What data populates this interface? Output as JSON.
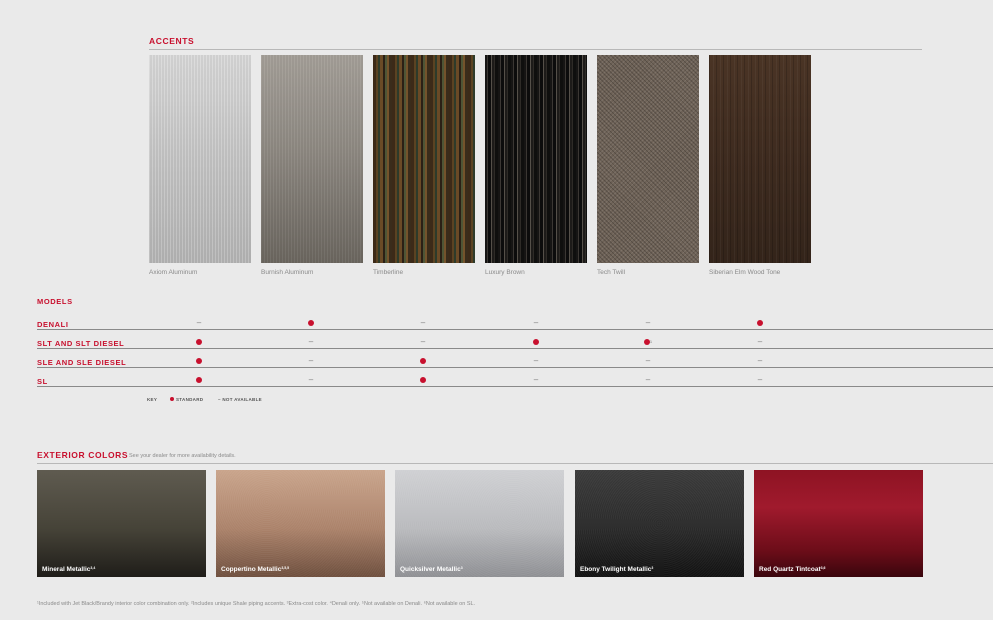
{
  "accents": {
    "title": "ACCENTS",
    "items": [
      {
        "label": "Axiom Aluminum",
        "swatch": "axiom-aluminum-swatch"
      },
      {
        "label": "Burnish Aluminum",
        "swatch": "burnish-aluminum-swatch"
      },
      {
        "label": "Timberline",
        "swatch": "timberline-swatch"
      },
      {
        "label": "Luxury Brown",
        "swatch": "luxury-brown-swatch"
      },
      {
        "label": "Tech Twill",
        "swatch": "tech-twill-swatch"
      },
      {
        "label": "Siberian Elm Wood Tone",
        "swatch": "siberian-elm-swatch"
      }
    ]
  },
  "models": {
    "title": "MODELS",
    "rows": [
      {
        "name": "DENALI",
        "cells": [
          "–",
          "●",
          "–",
          "–",
          "–",
          "●"
        ]
      },
      {
        "name": "SLT AND SLT DIESEL",
        "cells": [
          "●",
          "–",
          "–",
          "●",
          "●1",
          "–"
        ]
      },
      {
        "name": "SLE AND SLE DIESEL",
        "cells": [
          "●",
          "–",
          "●",
          "–",
          "–",
          "–"
        ]
      },
      {
        "name": "SL",
        "cells": [
          "●",
          "–",
          "●",
          "–",
          "–",
          "–"
        ]
      }
    ],
    "key": {
      "label": "KEY",
      "standard": "STANDARD",
      "not_available": "– NOT AVAILABLE"
    },
    "colors": {
      "accent": "#c8102e"
    }
  },
  "exterior": {
    "title": "EXTERIOR COLORS",
    "subtitle": "See your dealer for more availability details.",
    "colors": [
      {
        "name": "Mineral Metallic",
        "note": "3,4",
        "hex": "#4a473c"
      },
      {
        "name": "Coppertino Metallic",
        "note": "3,5,5",
        "hex": "#ab826a"
      },
      {
        "name": "Quicksilver Metallic",
        "note": "3",
        "hex": "#b9babd"
      },
      {
        "name": "Ebony Twilight Metallic",
        "note": "3",
        "hex": "#2a2a2a"
      },
      {
        "name": "Red Quartz Tintcoat",
        "note": "3,6",
        "hex": "#8e1323"
      }
    ]
  },
  "footnotes": "¹Included with Jet Black/Brandy interior color combination only.   ²Includes unique Shale piping accents.   ³Extra-cost color.   ⁴Denali only.   ⁵Not available on Denali.   ⁶Not available on SL."
}
